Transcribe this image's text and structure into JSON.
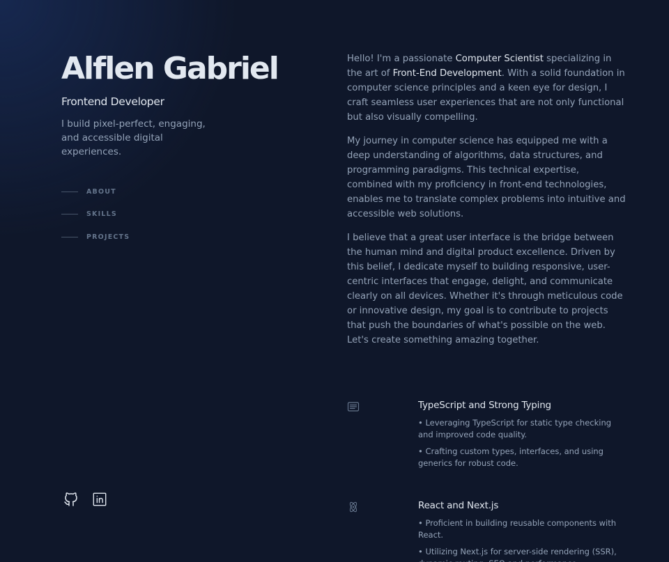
{
  "header": {
    "name": "Alflen Gabriel",
    "role": "Frontend Developer",
    "tagline": "I build pixel-perfect, engaging, and accessible digital experiences."
  },
  "nav": {
    "items": [
      {
        "label": "ABOUT"
      },
      {
        "label": "SKILLS"
      },
      {
        "label": "PROJECTS"
      }
    ]
  },
  "socials": {
    "items": [
      {
        "icon": "github-icon"
      },
      {
        "icon": "linkedin-icon"
      }
    ]
  },
  "about": {
    "p1_a": "Hello! I'm a passionate ",
    "p1_hl1": "Computer Scientist",
    "p1_b": " specializing in the art of ",
    "p1_hl2": "Front-End Development",
    "p1_c": ". With a solid foundation in computer science principles and a keen eye for design, I craft seamless user experiences that are not only functional but also visually compelling.",
    "p2": "My journey in computer science has equipped me with a deep understanding of algorithms, data structures, and programming paradigms. This technical expertise, combined with my proficiency in front-end technologies, enables me to translate complex problems into intuitive and accessible web solutions.",
    "p3": "I believe that a great user interface is the bridge between the human mind and digital product excellence. Driven by this belief, I dedicate myself to building responsive, user-centric interfaces that engage, delight, and communicate clearly on all devices. Whether it's through meticulous code or innovative design, my goal is to contribute to projects that push the boundaries of what's possible on the web. Let's create something amazing together."
  },
  "skills": [
    {
      "icon": "code-editor-icon",
      "title": "TypeScript and Strong Typing",
      "points": [
        "• Leveraging TypeScript for static type checking and improved code quality.",
        "• Crafting custom types, interfaces, and using generics for robust code."
      ]
    },
    {
      "icon": "react-atom-icon",
      "title": "React and Next.js",
      "points": [
        "• Proficient in building reusable components with React.",
        "• Utilizing Next.js for server-side rendering (SSR), dynamic routing, SEO and performance optimization."
      ]
    }
  ],
  "colors": {
    "background": "#0f172a",
    "heading": "#e2e8f0",
    "body_text": "#94a3b8",
    "muted": "#64748b"
  }
}
